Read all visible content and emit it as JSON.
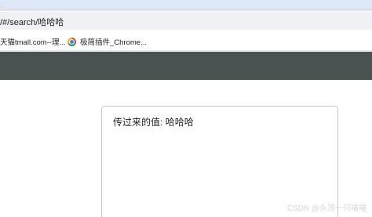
{
  "browser": {
    "address_text": "/#/search/哈哈哈",
    "bookmarks": [
      {
        "label": "天猫tmall.com--理..."
      },
      {
        "label": "极简插件_Chrome...",
        "icon": "chrome-icon"
      }
    ]
  },
  "page": {
    "card_label": "传过来的值:",
    "card_value": "哈哈哈",
    "header_color": "#4a5351"
  },
  "watermark": {
    "text": "CSDN @头顶一只喵喵"
  }
}
